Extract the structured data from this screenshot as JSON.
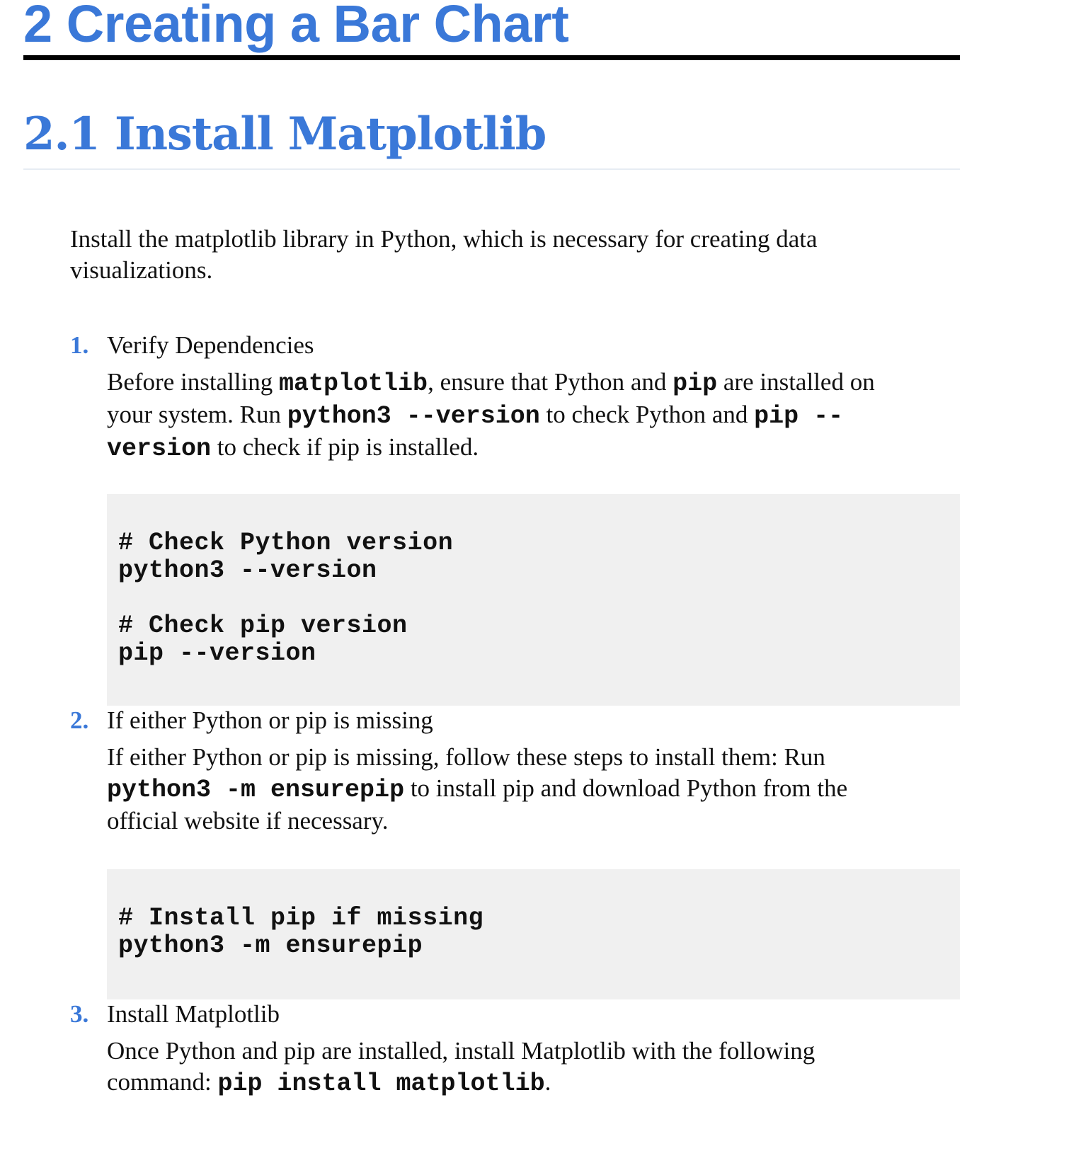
{
  "chapter": {
    "heading": "2 Creating a Bar Chart"
  },
  "section": {
    "heading": "2.1 Install Matplotlib",
    "intro": "Install the matplotlib library in Python, which is necessary for creating data visualizations."
  },
  "steps": [
    {
      "number": "1.",
      "title": "Verify Dependencies",
      "body": {
        "t1": "Before installing ",
        "c1": "matplotlib",
        "t2": ", ensure that Python and ",
        "c2": "pip",
        "t3": " are installed on your system. Run ",
        "c3": "python3 --version",
        "t4": " to check Python and ",
        "c4a": "pip --",
        "c4b": "version",
        "t5": " to check if pip is installed."
      },
      "code": [
        "# Check Python version",
        "python3 --version",
        "",
        "# Check pip version",
        "pip --version"
      ]
    },
    {
      "number": "2.",
      "title": "If either Python or pip is missing",
      "body": {
        "t1": "If either Python or pip is missing, follow these steps to install them: Run ",
        "c1": "python3 -m ensurepip",
        "t2": " to install pip and download Python from the official website if necessary."
      },
      "code": [
        "# Install pip if missing",
        "python3 -m ensurepip"
      ]
    },
    {
      "number": "3.",
      "title": "Install Matplotlib",
      "body": {
        "t1": "Once Python and pip are installed, install Matplotlib with the following command: ",
        "c1": "pip install matplotlib",
        "t2": "."
      }
    }
  ]
}
